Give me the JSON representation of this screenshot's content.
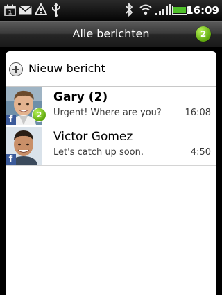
{
  "status_bar": {
    "time": "16:09",
    "icons": [
      "calendar-icon",
      "mail-icon",
      "warning-icon",
      "usb-icon",
      "bluetooth-icon",
      "wifi-icon",
      "signal-icon",
      "battery-icon"
    ]
  },
  "title_bar": {
    "title": "Alle berichten",
    "unread_count": "2"
  },
  "new_message": {
    "label": "Nieuw bericht"
  },
  "conversations": [
    {
      "name": "Gary (2)",
      "snippet": "Urgent! Where are you?",
      "time": "16:08",
      "unread": "2",
      "bold": true,
      "source": "facebook"
    },
    {
      "name": "Victor Gomez",
      "snippet": "Let's catch up soon.",
      "time": "4:50",
      "bold": false,
      "source": "facebook"
    }
  ],
  "colors": {
    "facebook": "#3b5a9a",
    "badge_green": "#6cb71b"
  },
  "facebook_badge": "f"
}
